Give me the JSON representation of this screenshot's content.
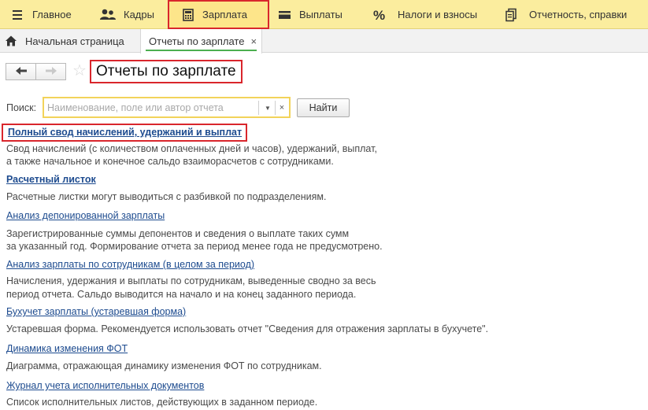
{
  "menu": {
    "items": [
      {
        "label": "Главное",
        "icon": "hamburger-icon"
      },
      {
        "label": "Кадры",
        "icon": "people-icon"
      },
      {
        "label": "Зарплата",
        "icon": "calculator-icon",
        "active": true
      },
      {
        "label": "Выплаты",
        "icon": "card-icon"
      },
      {
        "label": "Налоги и взносы",
        "icon": "percent-icon"
      },
      {
        "label": "Отчетность, справки",
        "icon": "documents-icon"
      }
    ]
  },
  "tabs": {
    "home_label": "Начальная страница",
    "active_label": "Отчеты по зарплате",
    "close_glyph": "×"
  },
  "page": {
    "title": "Отчеты по зарплате",
    "back_glyph": "🡐",
    "forward_glyph": "🡒"
  },
  "search": {
    "label": "Поиск:",
    "placeholder": "Наименование, поле или автор отчета",
    "value": "",
    "dropdown_glyph": "▼",
    "clear_glyph": "×",
    "button_label": "Найти"
  },
  "reports": [
    {
      "title": "Полный свод начислений, удержаний и выплат",
      "desc1": "Свод начислений (с количеством оплаченных дней и часов), удержаний, выплат,",
      "desc2": "а также начальное и конечное сальдо взаиморасчетов с сотрудниками."
    },
    {
      "title": "Расчетный листок",
      "desc1": "Расчетные листки могут выводиться с разбивкой по подразделениям.",
      "desc2": ""
    },
    {
      "title": "Анализ депонированной зарплаты",
      "desc1": "Зарегистрированные суммы депонентов и сведения о выплате таких сумм",
      "desc2": "за указанный год. Формирование отчета за период менее года не предусмотрено."
    },
    {
      "title": "Анализ зарплаты по сотрудникам (в целом за период)",
      "desc1": "Начисления, удержания и выплаты по сотрудникам, выведенные сводно за весь",
      "desc2": "период отчета. Сальдо выводится на начало и на конец заданного периода."
    },
    {
      "title": "Бухучет зарплаты (устаревшая форма)",
      "desc1": "Устаревшая форма. Рекомендуется использовать отчет \"Сведения для отражения зарплаты в бухучете\".",
      "desc2": ""
    },
    {
      "title": "Динамика изменения ФОТ",
      "desc1": "Диаграмма, отражающая динамику изменения ФОТ по сотрудникам.",
      "desc2": ""
    },
    {
      "title": "Журнал учета исполнительных документов",
      "desc1": "Список исполнительных листов, действующих в заданном периоде.",
      "desc2": ""
    }
  ],
  "colors": {
    "menu_bg": "#fbed9e",
    "highlight_red": "#d9262c",
    "link_blue": "#1d4b8f",
    "search_border": "#f2d35a",
    "tab_underline": "#4caf50"
  }
}
